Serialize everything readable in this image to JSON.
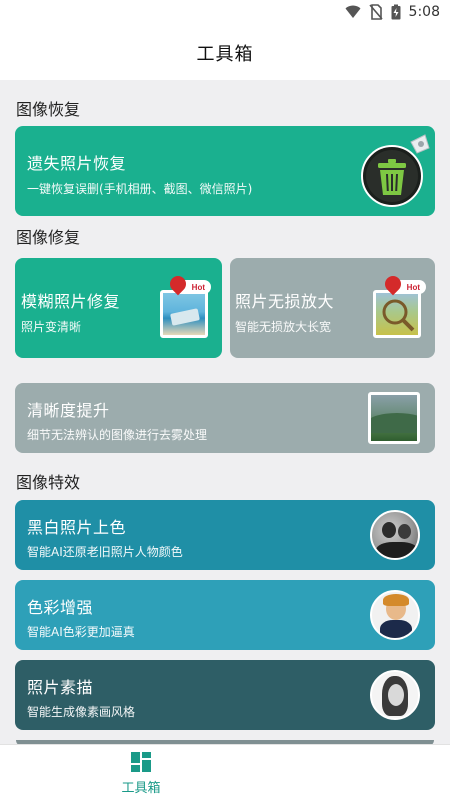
{
  "status": {
    "time": "5:08"
  },
  "header": {
    "title": "工具箱"
  },
  "sections": [
    {
      "title": "图像恢复"
    },
    {
      "title": "图像修复"
    },
    {
      "title": "图像特效"
    }
  ],
  "cards": {
    "lost_photo": {
      "title": "遗失照片恢复",
      "subtitle": "一键恢复误删(手机相册、截图、微信照片)"
    },
    "blur_fix": {
      "title": "模糊照片修复",
      "subtitle": "照片变清晰",
      "badge": "Hot"
    },
    "lossless_zoom": {
      "title": "照片无损放大",
      "subtitle": "智能无损放大长宽",
      "badge": "Hot"
    },
    "clarity": {
      "title": "清晰度提升",
      "subtitle": "细节无法辨认的图像进行去雾处理"
    },
    "colorize": {
      "title": "黑白照片上色",
      "subtitle": "智能AI还原老旧照片人物颜色"
    },
    "color_boost": {
      "title": "色彩增强",
      "subtitle": "智能AI色彩更加逼真"
    },
    "sketch": {
      "title": "照片素描",
      "subtitle": "智能生成像素画风格"
    }
  },
  "nav": {
    "label": "工具箱"
  },
  "colors": {
    "green": "#1ab08f",
    "gray_card": "#9cacad",
    "teal_dark": "#1f8fa6",
    "teal_mid": "#2ea0b8",
    "slate": "#2e5e66"
  }
}
